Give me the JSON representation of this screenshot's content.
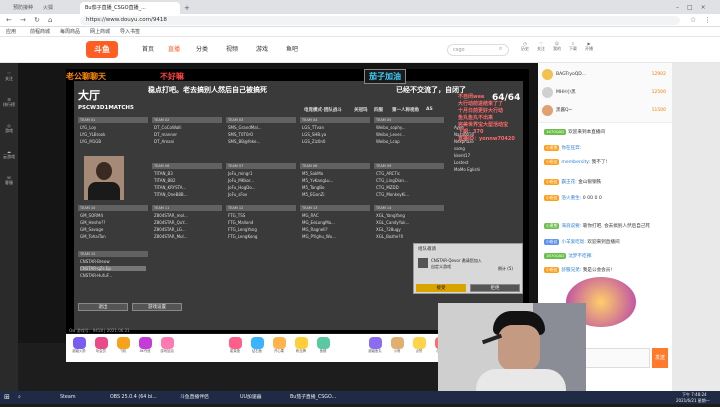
{
  "browser": {
    "tabs": [
      "预防接种",
      "火狐",
      "Bu茄子直播_CSGO直播_...",
      "新标签页"
    ],
    "url": "https://www.douyu.com/9418",
    "bookmarks": [
      "应用",
      "前程商城",
      "每周商品",
      "网上商城",
      "导入书签"
    ]
  },
  "header": {
    "logo": "斗鱼",
    "nav": [
      "首页",
      "直播",
      "分类",
      "视频",
      "游戏",
      "鱼吧"
    ],
    "search_placeholder": "csgo",
    "icons": [
      {
        "name": "history-icon",
        "label": "历史"
      },
      {
        "name": "follow-icon",
        "label": "关注"
      },
      {
        "name": "user-icon",
        "label": "我的"
      },
      {
        "name": "download-icon",
        "label": "下载"
      },
      {
        "name": "live-icon",
        "label": "开播"
      }
    ]
  },
  "sidebar": {
    "items": [
      "关注",
      "排行榜",
      "游戏",
      "云游戏",
      "客服"
    ]
  },
  "stream": {
    "overlays": {
      "top_left": "老公聊聊天",
      "top_mid": "不好嘛",
      "box": "茄子加油",
      "lobby": "大厅",
      "subtitle": "稳点打吧。老去搞别人然后自己被搞死",
      "right": "已经不交流了，自闭了",
      "counter": "64/64",
      "room_name": "PSCW3D1MATCH5",
      "mode": "电竞模式·团队战斗",
      "mode_ext": "关冠玛",
      "mode_ext2": "四服",
      "mode_ext3": "第一人称视角",
      "mode_ext4": "AS",
      "streamer_tag": "不自闭wee",
      "donation_lines": [
        "大行动前进结束了了",
        "十月日前更好大行动",
        "鱼丸鱼丸不出来",
        "完美世界宝大型活动宝",
        "下期：370"
      ],
      "id_line": "直播ID：yonnw70420"
    },
    "teams": [
      {
        "header": "TEAM 01",
        "players": [
          "LYG_Loy",
          "LYG_YLBrook",
          "LYG_M1GB"
        ]
      },
      {
        "header": "TEAM 02",
        "players": [
          "DT_CoCoWalli",
          "DT_manner",
          "DT_Amani"
        ]
      },
      {
        "header": "TEAM 03",
        "players": [
          "SMS_GrandMal...",
          "SMS_T0T0rO",
          "SMS_BB@feke..."
        ]
      },
      {
        "header": "TEAM 04",
        "players": [
          "LGS_TTvan",
          "LGS_SHB.ya",
          "LGS_Ziz0n0"
        ]
      },
      {
        "header": "TEAM 05",
        "players": [
          "Weibo_sophy...",
          "Weibo_Lever...",
          "Weibo_Lcap"
        ]
      },
      {
        "header": "TEAM 06",
        "players": [
          "TITAN_B3",
          "TITAN_BB2",
          "TITAN_KRYSTA..."
        ]
      },
      {
        "header": "TEAM 07",
        "players": [
          "JoFu_mingr1",
          "JoFu_MKkor...",
          "JoFu_HogDo..."
        ]
      },
      {
        "header": "TEAM 08",
        "players": [
          "M5_SakMo",
          "M5_YvKangLu...",
          "M5_TangBo"
        ]
      },
      {
        "header": "TEAM 09",
        "players": [
          "CTG_ARCTic",
          "CTG_LingDian...",
          "CTG_MZDD"
        ]
      },
      {
        "header": "TEAM 10",
        "players": [
          "GM_SORM4",
          "GM_Heshe??",
          "GM_Savage"
        ]
      },
      {
        "header": "TEAM 11",
        "players": [
          "Z804STAR_mol...",
          "Z804STAR_QuY...",
          "Z804STAR_LG..."
        ]
      },
      {
        "header": "TEAM 12",
        "players": [
          "FTG_TSS",
          "FTG_Mallon4",
          "FTG_LengYang"
        ]
      },
      {
        "header": "TEAM 13",
        "players": [
          "MG_RAC",
          "MG_EeLongMa...",
          "MG_Ragnell?"
        ]
      },
      {
        "header": "TEAM 14",
        "players": [
          "XGL_YangYang",
          "XGL_CandyYuk...",
          "XGL_?28ugy"
        ]
      },
      {
        "header": "TEAM 15",
        "players": [
          "CNSTAR-Breow",
          "CNSTAR-qZs.Ep",
          "CNSTAR-HufuF..."
        ]
      }
    ],
    "extra_players": [
      "Ayee",
      "Naza0030",
      "Nexphaze",
      "samg",
      "kkent17",
      "Lostest",
      "MoMo Eglishi",
      "TITAN_OneB8B...",
      "JoFu_sFov",
      "M5_EGonZi",
      "CTG_MonkeyKi...",
      "GM_TohaiTan",
      "Z804STAR_Mul...",
      "FTG_LengKong",
      "MG_PYighu_Wu...",
      "XGL_Bozhe?X"
    ],
    "buttons": {
      "exit": "退出",
      "settings": "游戏设置"
    },
    "invite": {
      "title": "组队邀请",
      "msg": "CNSTAR-Qevor 邀请您加入",
      "msg2": "自定义游戏",
      "accept": "接受",
      "decline": "拒绝",
      "countdown": "倒计 (5)"
    },
    "status": "Ow 游戏号：9418 | 2021.06.21"
  },
  "gifts": [
    "超级火箭",
    "玩会员",
    "飞机",
    "8K夺冠",
    "游戏加油",
    "能量值",
    "钻石鱼",
    "开心果",
    "粉丝牌",
    "鱼翅",
    "超级鱼丸",
    "小熊",
    "点赞",
    "小心心"
  ],
  "ranks": [
    {
      "name": "BAGTryoQD...",
      "score": "12902",
      "color": "#f2c14e"
    },
    {
      "name": "MHH小黑",
      "score": "12500",
      "color": "#d0d0d0"
    },
    {
      "name": "黑酱Q~",
      "score": "11500",
      "color": "#e0a070"
    }
  ],
  "chat": [
    {
      "badge": "1670QAD",
      "name": "",
      "text": "欢迎来到本直播间"
    },
    {
      "badge": "小黑熊",
      "name": "你在狂奔:",
      "text": ""
    },
    {
      "badge": "小粉丝",
      "name": "membersity:",
      "text": "我不了!"
    },
    {
      "badge": "小粉丝",
      "name": "霸王花:",
      "text": "金山银钢铁"
    },
    {
      "badge": "小粉丝",
      "name": "浴火重生:",
      "text": "0 00 0 0"
    },
    {
      "badge": "小黑熊",
      "name": "海浪说要:",
      "text": "靠你打吧, 会去搞别人然后自己死"
    },
    {
      "badge": "小粉丝",
      "name": "小羊爱吃饭:",
      "text": "欢迎来到直播间"
    },
    {
      "badge": "1670QAD",
      "name": "沈梦不吃辣:",
      "text": ""
    },
    {
      "badge": "小粉丝",
      "name": "舒服兄弟:",
      "text": "我是公会会员!"
    }
  ],
  "chat_input": {
    "placeholder": "发言前请先登录",
    "send": "发送"
  },
  "taskbar": {
    "items": [
      "Steam",
      "OBS 25.0.4 (64 bi...",
      "斗鱼直播伴侣",
      "UU加速器",
      "Bu茄子直播_CSGO..."
    ],
    "time": "下午 7:48:24",
    "date": "2021/6/21 星期一"
  }
}
